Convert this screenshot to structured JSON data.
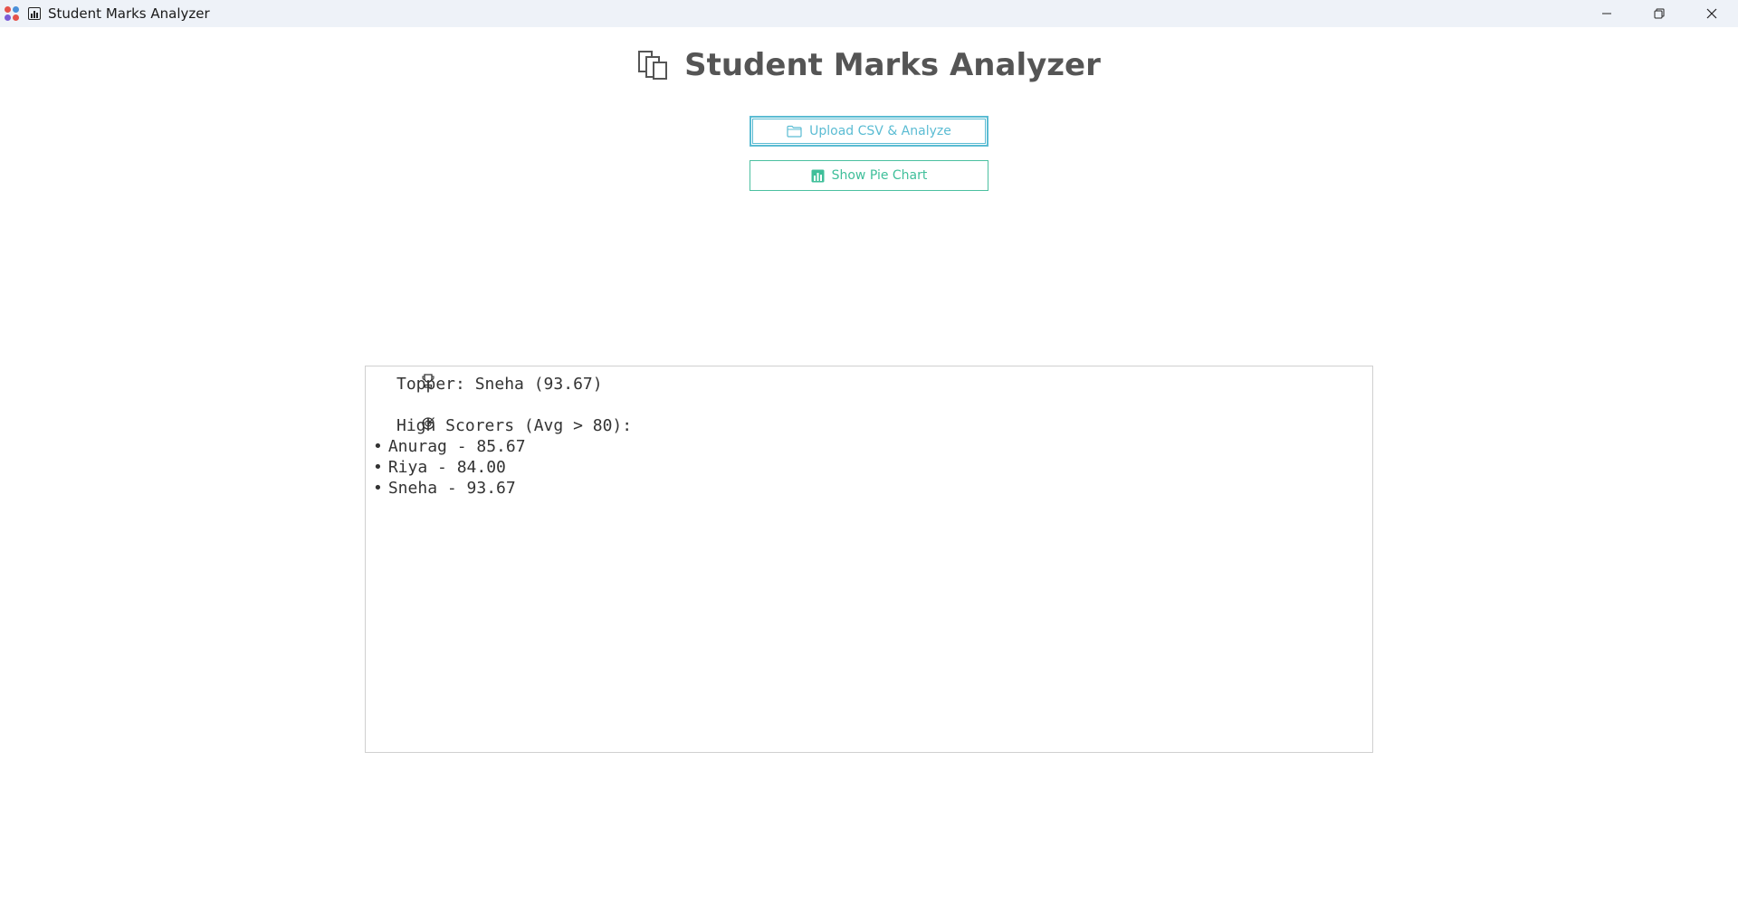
{
  "window": {
    "title": "Student Marks Analyzer",
    "controls": {
      "minimize": "minimize-icon",
      "maximize": "restore-icon",
      "close": "close-icon"
    }
  },
  "header": {
    "icon": "books-icon",
    "title": "Student Marks Analyzer"
  },
  "buttons": {
    "upload": {
      "icon": "folder-icon",
      "label": "Upload CSV & Analyze"
    },
    "pie": {
      "icon": "bar-chart-icon",
      "label": "Show Pie Chart"
    }
  },
  "output": {
    "topper_icon": "trophy-icon",
    "topper_text": "Topper: Sneha (93.67)",
    "high_scorers_icon": "target-icon",
    "high_scorers_heading": "High Scorers (Avg > 80):",
    "bullet": "•",
    "high_scorers": [
      {
        "text": "Anurag - 85.67"
      },
      {
        "text": "Riya - 84.00"
      },
      {
        "text": "Sneha - 93.67"
      }
    ]
  },
  "colors": {
    "heading": "#555555",
    "upload_accent": "#5bbcd3",
    "pie_accent": "#3fbf9a",
    "titlebar_bg": "#eef2f8"
  }
}
